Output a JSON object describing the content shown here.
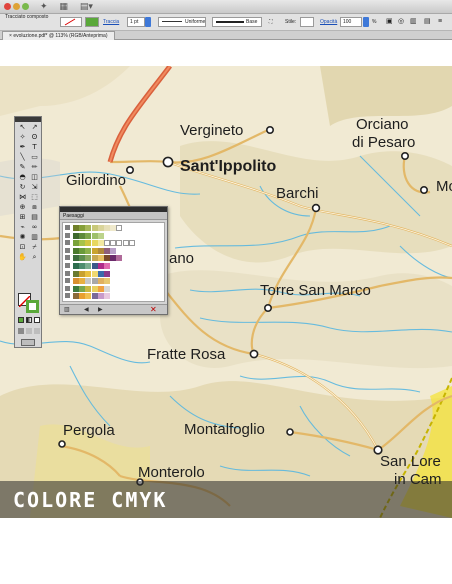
{
  "app": {
    "control_bar": {
      "object_label": "Tracciato composto",
      "stroke_label": "Traccia",
      "stroke_weight": "1 pt",
      "profile_label": "Uniforme",
      "brush_label": "Base",
      "style_label": "Stile:",
      "opacity_label": "Opacità",
      "opacity_value": "100",
      "opacity_unit": "%"
    },
    "document_tab": "evoluzione.pdf* @ 113% (RGB/Anteprima)",
    "swatches_panel": {
      "title": "Paesaggi",
      "rows": [
        [
          "#6f7f28",
          "#86a03a",
          "#a8b85a",
          "#c8c878",
          "#d9d49a",
          "#e6dfb7",
          "#efe9cc",
          "#ffffff"
        ],
        [
          "#3f6a2e",
          "#5f8a3e",
          "#7ea64e",
          "#9ec06a",
          "#bcd38b"
        ],
        [
          "#79a33a",
          "#a6c24a",
          "#d0c640",
          "#e8d860",
          "#f2e9a0",
          "#fff",
          "#ffffff",
          "#ffffff",
          "#ffffff",
          "#fff"
        ],
        [
          "#4b7a2e",
          "#6a9a3a",
          "#8cb04a",
          "#c9a32e",
          "#b0883a",
          "#8f5f7a",
          "#b9a0c8"
        ],
        [
          "#3e6e3e",
          "#5e8e4e",
          "#8aa860",
          "#c6a850",
          "#e6c060",
          "#7a4a2a",
          "#6a2a6a",
          "#b06a9a"
        ],
        [
          "#2e6e4e",
          "#4e8e6e",
          "#7aae8e",
          "#3a5a8a",
          "#b02a8a",
          "#e06ab0"
        ],
        [
          "#6a7a2e",
          "#c8a030",
          "#e8c040",
          "#f0d870",
          "#3a6aaa",
          "#8a3a8a"
        ],
        [
          "#d89030",
          "#e8b040",
          "#c8c8c8",
          "#a8a8a8",
          "#e0b060",
          "#e8c870"
        ],
        [
          "#3e7a3e",
          "#7aa84e",
          "#c8b840",
          "#e8d060",
          "#f0a040",
          "#d8d8d8"
        ],
        [
          "#8a6a3a",
          "#e8a030",
          "#f0c050",
          "#7a6a9a",
          "#c89aca",
          "#e8c8e0"
        ]
      ]
    }
  },
  "map": {
    "places": [
      {
        "name": "Vergineto"
      },
      {
        "name": "Orciano"
      },
      {
        "name": "di Pesaro"
      },
      {
        "name": "Sant'Ippolito"
      },
      {
        "name": "Gilordino"
      },
      {
        "name": "Barchi"
      },
      {
        "name": "Mo"
      },
      {
        "name": "ano"
      },
      {
        "name": "Torre San Marco"
      },
      {
        "name": "Fratte Rosa"
      },
      {
        "name": "Pergola"
      },
      {
        "name": "Montalfoglio"
      },
      {
        "name": "San Lore"
      },
      {
        "name": "in Cam"
      },
      {
        "name": "Monterolo"
      }
    ]
  },
  "caption": {
    "text": "COLORE CMYK"
  }
}
